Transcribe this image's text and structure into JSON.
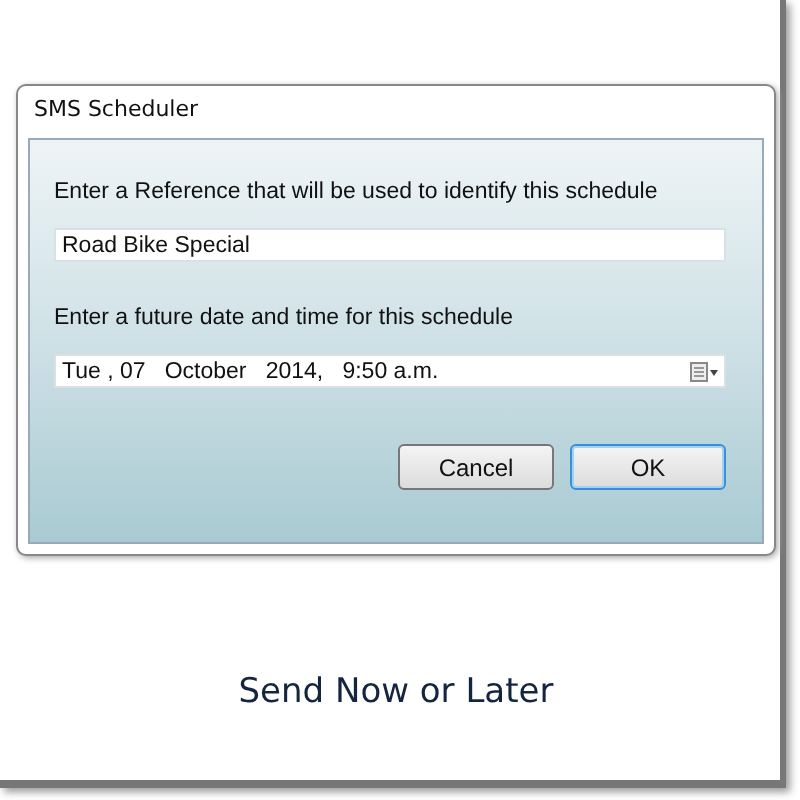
{
  "window": {
    "title": "SMS Scheduler"
  },
  "reference": {
    "label": "Enter a Reference that will be used to identify this schedule",
    "value": "Road Bike Special"
  },
  "datetime": {
    "label": "Enter a future date and time for this schedule",
    "value": "Tue , 07   October   2014,   9:50 a.m."
  },
  "buttons": [
    {
      "label": "Cancel",
      "default": false
    },
    {
      "label": "OK",
      "default": true
    }
  ],
  "caption": "Send Now or Later"
}
